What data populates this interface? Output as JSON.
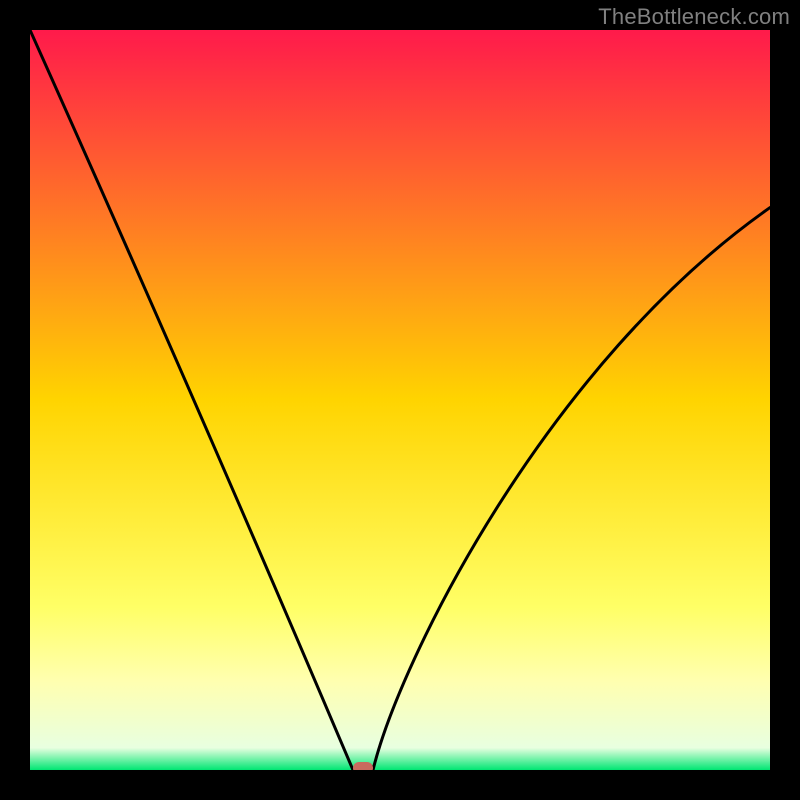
{
  "watermark": "TheBottleneck.com",
  "chart_data": {
    "type": "line",
    "title": "",
    "xlabel": "",
    "ylabel": "",
    "xlim": [
      0,
      100
    ],
    "ylim": [
      0,
      100
    ],
    "gradient_stops": [
      {
        "offset": 0.0,
        "color": "#ff1a4b"
      },
      {
        "offset": 0.5,
        "color": "#ffd400"
      },
      {
        "offset": 0.78,
        "color": "#ffff66"
      },
      {
        "offset": 0.88,
        "color": "#ffffb0"
      },
      {
        "offset": 0.97,
        "color": "#e8ffe0"
      },
      {
        "offset": 1.0,
        "color": "#00e673"
      }
    ],
    "series": [
      {
        "name": "bottleneck-curve",
        "x": [
          0,
          10,
          20,
          30,
          35,
          38,
          40,
          42,
          44,
          45,
          46,
          50,
          55,
          60,
          65,
          70,
          75,
          80,
          85,
          90,
          95,
          100
        ],
        "y": [
          100,
          79,
          58,
          36,
          25,
          18,
          12,
          6,
          2,
          0,
          2,
          13,
          25,
          35,
          44,
          51,
          57,
          62,
          66,
          70,
          73,
          76
        ]
      }
    ],
    "marker": {
      "x": 45,
      "y": 0,
      "label": "optimum-marker"
    }
  }
}
